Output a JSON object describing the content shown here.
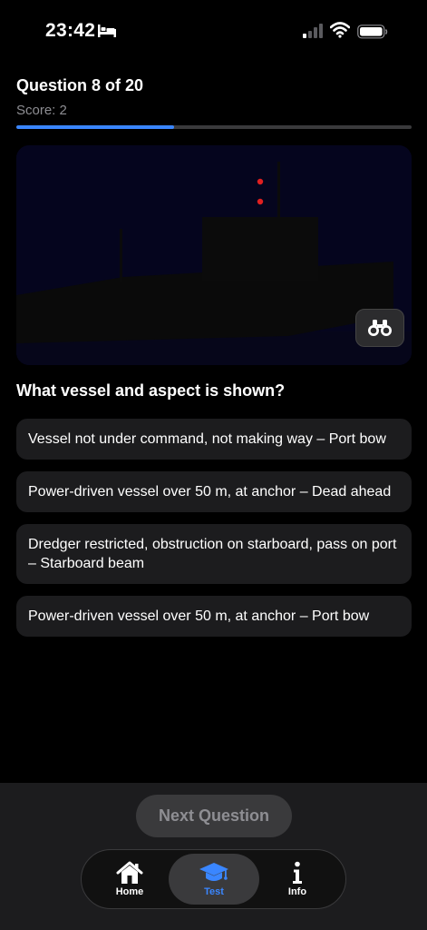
{
  "status_bar": {
    "time": "23:42",
    "icons": [
      "bed-icon",
      "cellular-signal-icon",
      "wifi-icon",
      "battery-icon"
    ]
  },
  "quiz": {
    "question_counter": "Question 8 of 20",
    "score_text": "Score: 2",
    "progress_fraction": 0.4,
    "prompt": "What vessel and aspect is shown?",
    "answers": [
      "Vessel not under command, not making way – Port bow",
      "Power-driven vessel over 50 m, at anchor – Dead ahead",
      "Dredger restricted, obstruction on starboard, pass on port – Starboard beam",
      "Power-driven vessel over 50 m, at anchor – Port bow"
    ],
    "scene_lights": [
      "red",
      "red"
    ],
    "binoculars_icon": "binoculars-icon"
  },
  "footer": {
    "next_label": "Next Question"
  },
  "tabs": [
    {
      "label": "Home",
      "icon": "house-icon",
      "active": false
    },
    {
      "label": "Test",
      "icon": "graduation-cap-icon",
      "active": true
    },
    {
      "label": "Info",
      "icon": "info-icon",
      "active": false
    }
  ],
  "colors": {
    "accent": "#3a86ff",
    "background": "#000000",
    "card": "#1c1c1e",
    "light_red": "#e02020"
  }
}
